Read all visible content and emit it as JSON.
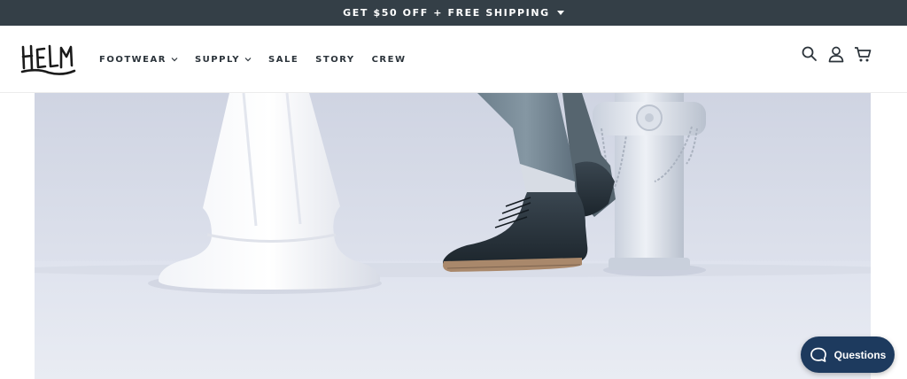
{
  "promo": {
    "text": "GET $50 OFF + FREE SHIPPING",
    "icon": "caret-down-icon"
  },
  "brand": {
    "logo_text": "HELM"
  },
  "nav": {
    "items": [
      {
        "label": "FOOTWEAR",
        "has_dropdown": true
      },
      {
        "label": "SUPPLY",
        "has_dropdown": true
      },
      {
        "label": "SALE",
        "has_dropdown": false
      },
      {
        "label": "STORY",
        "has_dropdown": false
      },
      {
        "label": "CREW",
        "has_dropdown": false
      }
    ]
  },
  "header_icons": [
    "search-icon",
    "account-icon",
    "cart-icon"
  ],
  "chat": {
    "label": "Questions",
    "icon": "chat-bubble-icon"
  },
  "colors": {
    "promo_bg": "#343f47",
    "nav_text": "#2b333a",
    "chat_bg": "#1d3a5e",
    "hero_bg": "#d9dde8"
  }
}
